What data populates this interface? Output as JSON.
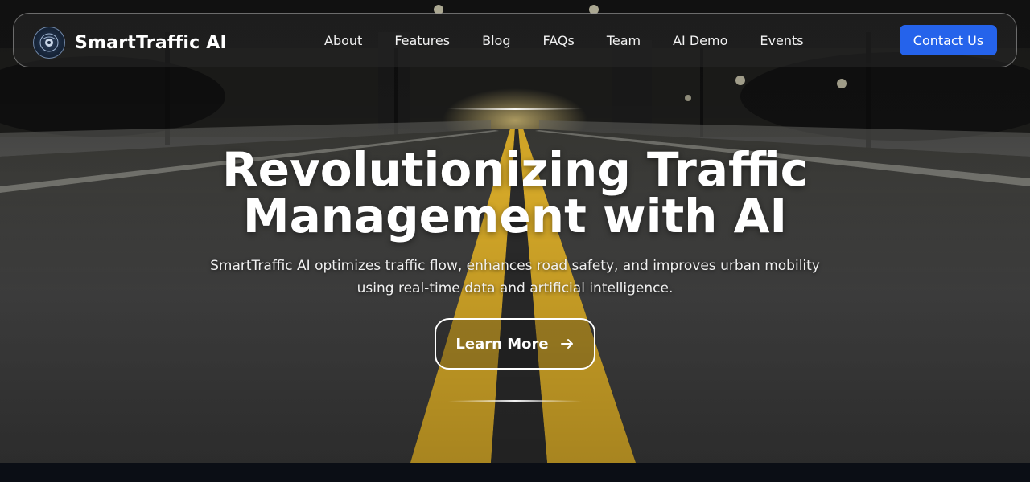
{
  "brand": {
    "name": "SmartTraffic AI",
    "logo_icon": "traffic-light-badge-icon"
  },
  "nav": {
    "items": [
      {
        "label": "About"
      },
      {
        "label": "Features"
      },
      {
        "label": "Blog"
      },
      {
        "label": "FAQs"
      },
      {
        "label": "Team"
      },
      {
        "label": "AI Demo"
      },
      {
        "label": "Events"
      }
    ],
    "contact_label": "Contact Us"
  },
  "hero": {
    "headline_line1": "Revolutionizing Traffic",
    "headline_line2": "Management with AI",
    "subheading_line1": "SmartTraffic AI optimizes traffic flow, enhances road safety, and improves urban mobility",
    "subheading_line2": "using real-time data and artificial intelligence.",
    "cta_label": "Learn More",
    "cta_icon": "arrow-right-icon",
    "background": "night-road-photo"
  },
  "colors": {
    "accent": "#2563eb",
    "lane_yellow": "#e0b12a",
    "footer_band": "#0b0e15"
  }
}
